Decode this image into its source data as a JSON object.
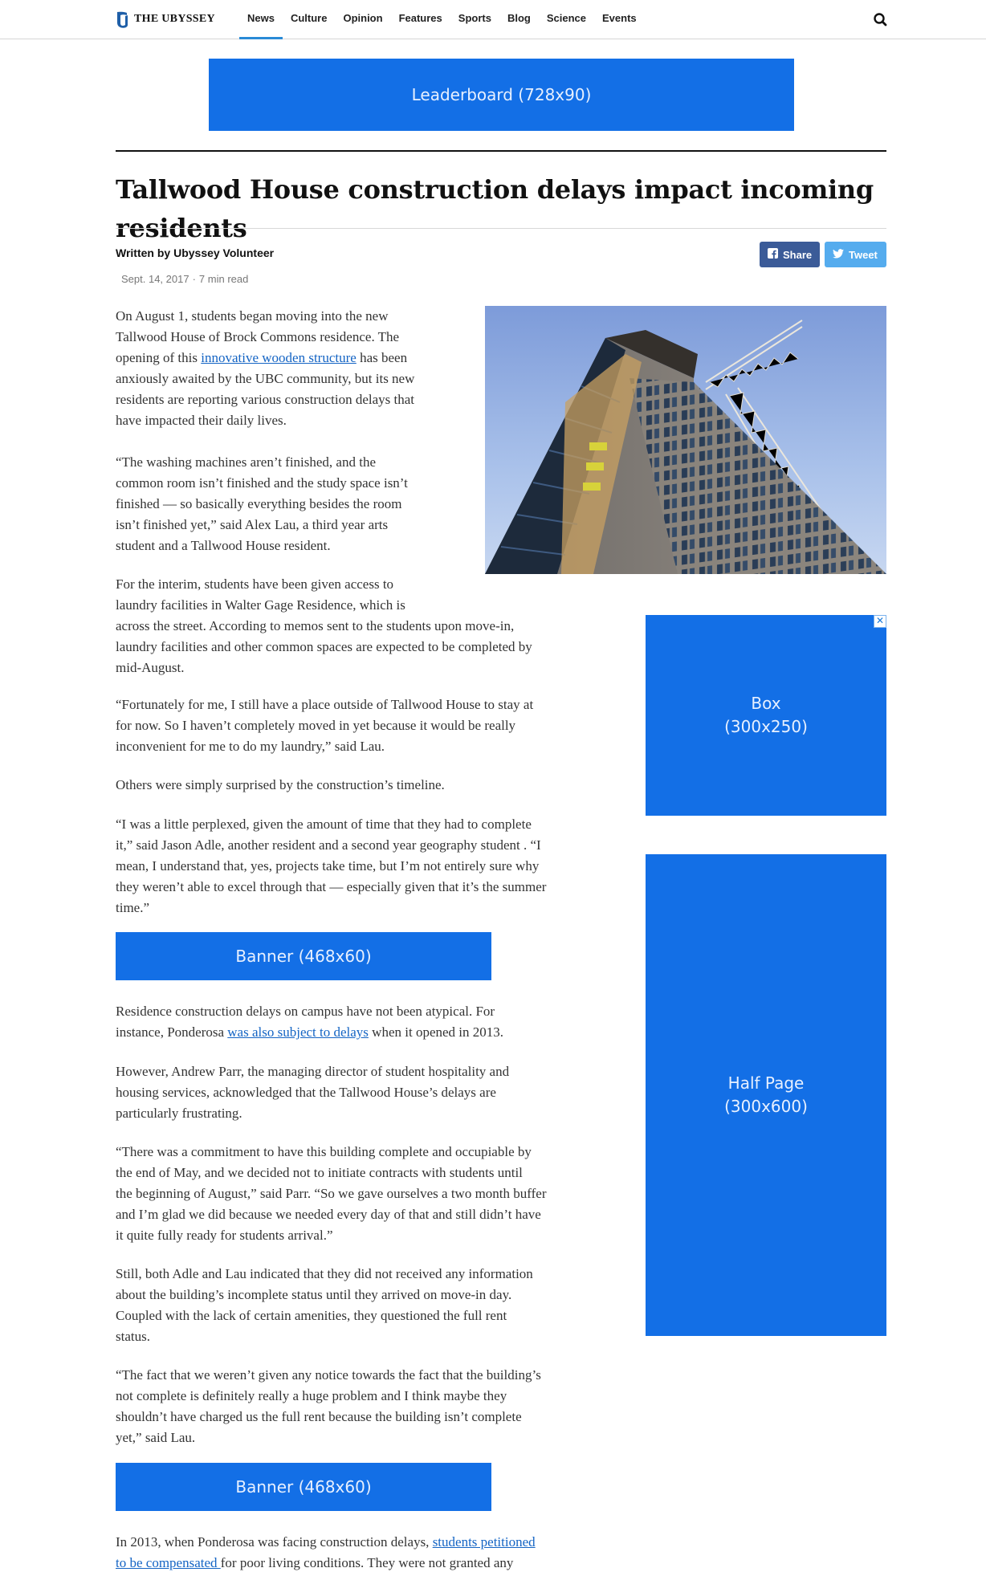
{
  "nav": {
    "logo_text": "THE UBYSSEY",
    "links": [
      "News",
      "Culture",
      "Opinion",
      "Features",
      "Sports",
      "Blog",
      "Science",
      "Events"
    ]
  },
  "ads": {
    "leaderboard": "Leaderboard (728x90)",
    "box_line1": "Box",
    "box_line2": "(300x250)",
    "half_line1": "Half Page",
    "half_line2": "(300x600)",
    "banner1": "Banner (468x60)",
    "banner2": "Banner (468x60)",
    "adchoice": "✕"
  },
  "article": {
    "headline": "Tallwood House construction delays impact incoming residents",
    "byline": "Written by Ubyssey Volunteer",
    "date": "Sept. 14, 2017",
    "read_time": "7 min read",
    "share_fb": "Share",
    "share_tw": "Tweet",
    "p1": {
      "line1": "On August 1, students began moving into the new",
      "line2": "Tallwood House of Brock Commons residence. The",
      "line3_pre": "opening of this ",
      "line3_link": "innovative wooden structure",
      "line3_post": " has been",
      "line4": "anxiously awaited by the UBC community, but its new",
      "line5": "residents are reporting various construction delays that",
      "line6": "have impacted their daily lives."
    },
    "p2": [
      "“The washing machines aren’t finished, and the",
      "common room isn’t finished and the study space isn’t",
      "finished — so basically everything besides the room",
      "isn’t finished yet,” said Alex Lau, a third year arts",
      "student and a Tallwood House resident."
    ],
    "p3": [
      "For the interim, students have been given access to",
      "laundry facilities in Walter Gage Residence, which is",
      "across the street. According to memos sent to the students upon move-in,",
      "laundry facilities and other common spaces are expected to be completed by",
      "mid-August."
    ],
    "p4": [
      "“Fortunately for me, I still have a place outside of Tallwood House to stay at",
      "for now. So I haven’t completely moved in yet because it would be really",
      "inconvenient for me to do my laundry,” said Lau."
    ],
    "p5": "Others were simply surprised by the construction’s timeline.",
    "p6": [
      "“I was a little perplexed, given the amount of time that they had to complete",
      "it,” said Jason Adle, another resident and a second year geography student . “I",
      "mean, I understand that, yes, projects take time, but I’m not entirely sure why",
      "they weren’t able to excel through that — especially given that it’s the summer",
      "time.”"
    ],
    "p7": {
      "line1": "Residence construction delays on campus have not been atypical. For",
      "line2_pre": "instance, Ponderosa ",
      "line2_link": "was also subject to delays",
      "line2_post": " when it opened in 2013."
    },
    "p8": [
      "However, Andrew Parr, the managing director of student hospitality and",
      "housing services, acknowledged that the Tallwood House’s delays are",
      "particularly frustrating."
    ],
    "p9": [
      "“There was a commitment to have this building complete and occupiable by",
      "the end of May, and we decided not to initiate contracts with students until",
      "the beginning of August,” said Parr. “So we gave ourselves a two month buffer",
      "and I’m glad we did because we needed every day of that and still didn’t have",
      "it quite fully ready for students arrival.”"
    ],
    "p10": [
      "Still, both Adle and Lau indicated that they did not received any information",
      "about the building’s incomplete status until they arrived on move-in day.",
      "Coupled with the lack of certain amenities, they questioned the full rent",
      "status."
    ],
    "p11": [
      "“The fact that we weren’t given any notice towards the fact that the building’s",
      "not complete is definitely really a huge problem and I think maybe they",
      "shouldn’t have charged us the full rent because the building isn’t complete",
      "yet,” said Lau."
    ],
    "p12": {
      "line1_pre": "In 2013, when Ponderosa was facing construction delays, ",
      "line1_link": "students petitioned",
      "line2_link": "to be compensated ",
      "line2_post": "for poor living conditions. They were not granted any"
    }
  }
}
